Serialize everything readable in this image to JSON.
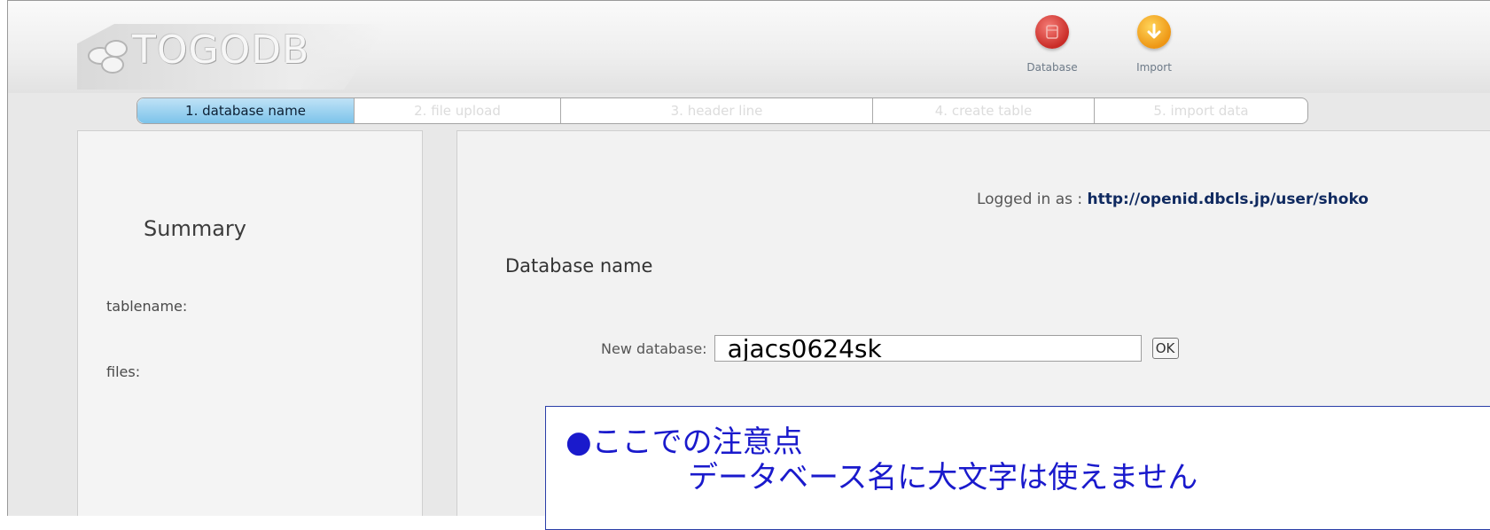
{
  "app": {
    "logo": "TOGODB",
    "nav": [
      {
        "label": "Database",
        "icon": "database-icon",
        "color": "#d8403d"
      },
      {
        "label": "Import",
        "icon": "import-arrow-icon",
        "color": "#f3a21c"
      }
    ]
  },
  "steps": [
    {
      "label": "1. database name",
      "active": true
    },
    {
      "label": "2. file upload",
      "active": false
    },
    {
      "label": "3. header line",
      "active": false
    },
    {
      "label": "4. create table",
      "active": false
    },
    {
      "label": "5. import data",
      "active": false
    }
  ],
  "summary": {
    "title": "Summary",
    "tablename_label": "tablename:",
    "files_label": "files:"
  },
  "main": {
    "logged_in_label": "Logged in as :",
    "logged_in_user": "http://openid.dbcls.jp/user/shoko",
    "section_title": "Database name",
    "new_database_label": "New database:",
    "new_database_value": "ajacs0624sk",
    "ok_label": "OK"
  },
  "callout": {
    "line1": "●ここでの注意点",
    "line2": "データベース名に大文字は使えません"
  }
}
